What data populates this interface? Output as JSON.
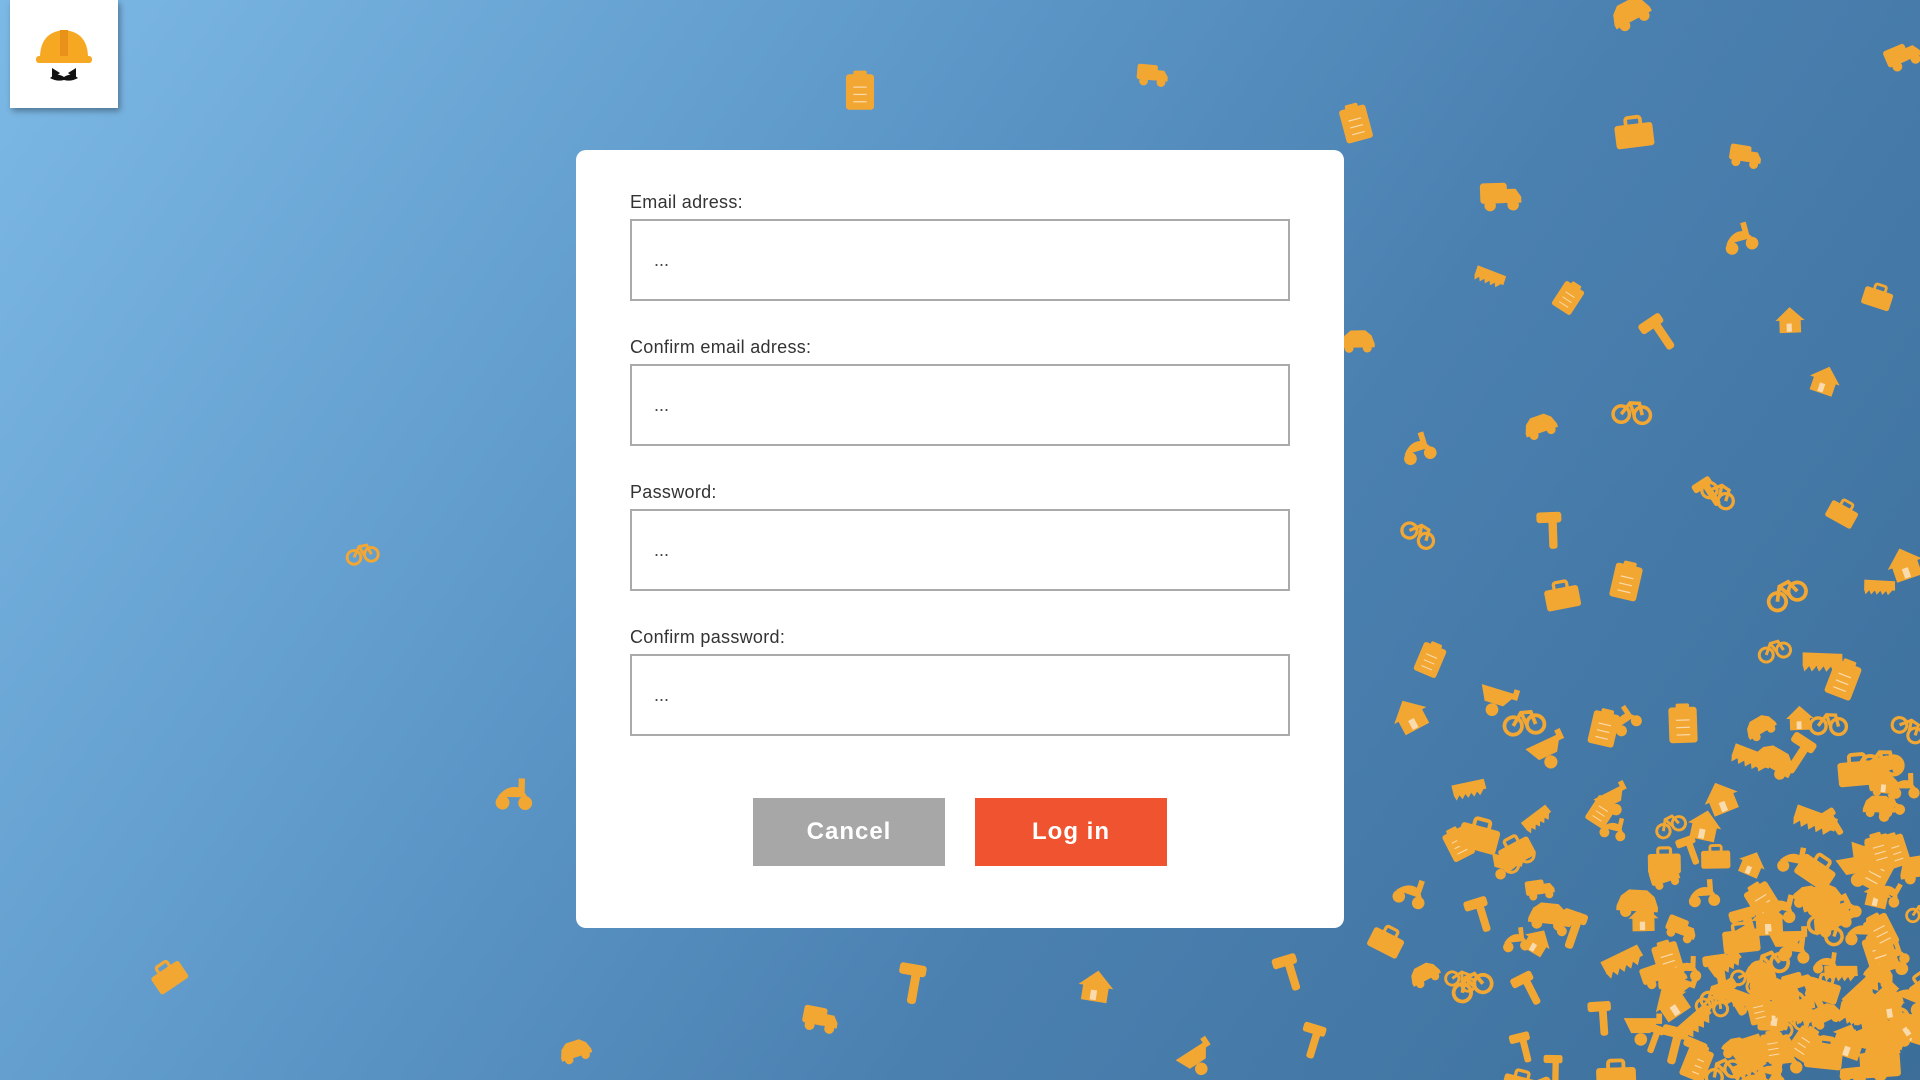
{
  "colors": {
    "accent_orange": "#f3a733",
    "login_button": "#f0532f",
    "cancel_button": "#a7a7a7",
    "background_top_left": "#7db9e6",
    "background_bottom_right": "#3c6e99"
  },
  "logo": {
    "icon": "hardhat-mustache-logo-icon"
  },
  "background": {
    "icon_kinds": [
      "house-icon",
      "hammer-icon",
      "bicycle-icon",
      "scooter-icon",
      "truck-icon",
      "car-icon",
      "wheelbarrow-icon",
      "saw-icon",
      "clipboard-icon",
      "toolbox-icon"
    ]
  },
  "form": {
    "fields": [
      {
        "label": "Email adress:",
        "placeholder": "..."
      },
      {
        "label": "Confirm email adress:",
        "placeholder": "..."
      },
      {
        "label": "Password:",
        "placeholder": "..."
      },
      {
        "label": "Confirm password:",
        "placeholder": "..."
      }
    ],
    "cancel_label": "Cancel",
    "login_label": "Log in"
  }
}
